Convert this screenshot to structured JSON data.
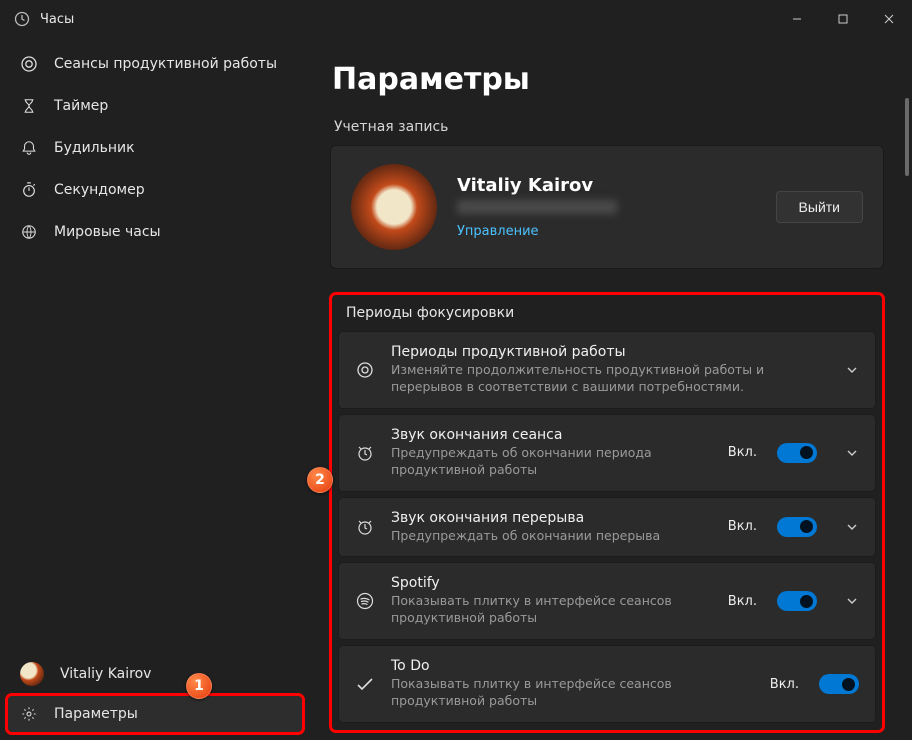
{
  "app": {
    "title": "Часы"
  },
  "sidebar": {
    "items": [
      {
        "label": "Сеансы продуктивной работы",
        "icon": "target-icon"
      },
      {
        "label": "Таймер",
        "icon": "hourglass-icon"
      },
      {
        "label": "Будильник",
        "icon": "bell-icon"
      },
      {
        "label": "Секундомер",
        "icon": "stopwatch-icon"
      },
      {
        "label": "Мировые часы",
        "icon": "globe-icon"
      }
    ],
    "user": {
      "name": "Vitaliy Kairov"
    },
    "settings_label": "Параметры"
  },
  "main": {
    "heading": "Параметры",
    "account": {
      "section_label": "Учетная запись",
      "name": "Vitaliy Kairov",
      "manage": "Управление",
      "signout": "Выйти"
    },
    "focus": {
      "section_label": "Периоды фокусировки",
      "rows": [
        {
          "title": "Периоды продуктивной работы",
          "desc": "Изменяйте продолжительность продуктивной работы и перерывов в соответствии с вашими потребностями.",
          "has_toggle": false,
          "has_chevron": true
        },
        {
          "title": "Звук окончания сеанса",
          "desc": "Предупреждать об окончании периода продуктивной работы",
          "has_toggle": true,
          "toggle_label": "Вкл.",
          "has_chevron": true
        },
        {
          "title": "Звук окончания перерыва",
          "desc": "Предупреждать об окончании перерыва",
          "has_toggle": true,
          "toggle_label": "Вкл.",
          "has_chevron": true
        },
        {
          "title": "Spotify",
          "desc": "Показывать плитку в интерфейсе сеансов продуктивной работы",
          "has_toggle": true,
          "toggle_label": "Вкл.",
          "has_chevron": true
        },
        {
          "title": "To Do",
          "desc": "Показывать плитку в интерфейсе сеансов продуктивной работы",
          "has_toggle": true,
          "toggle_label": "Вкл.",
          "has_chevron": false
        }
      ]
    }
  },
  "annotations": {
    "badge1": "1",
    "badge2": "2"
  }
}
